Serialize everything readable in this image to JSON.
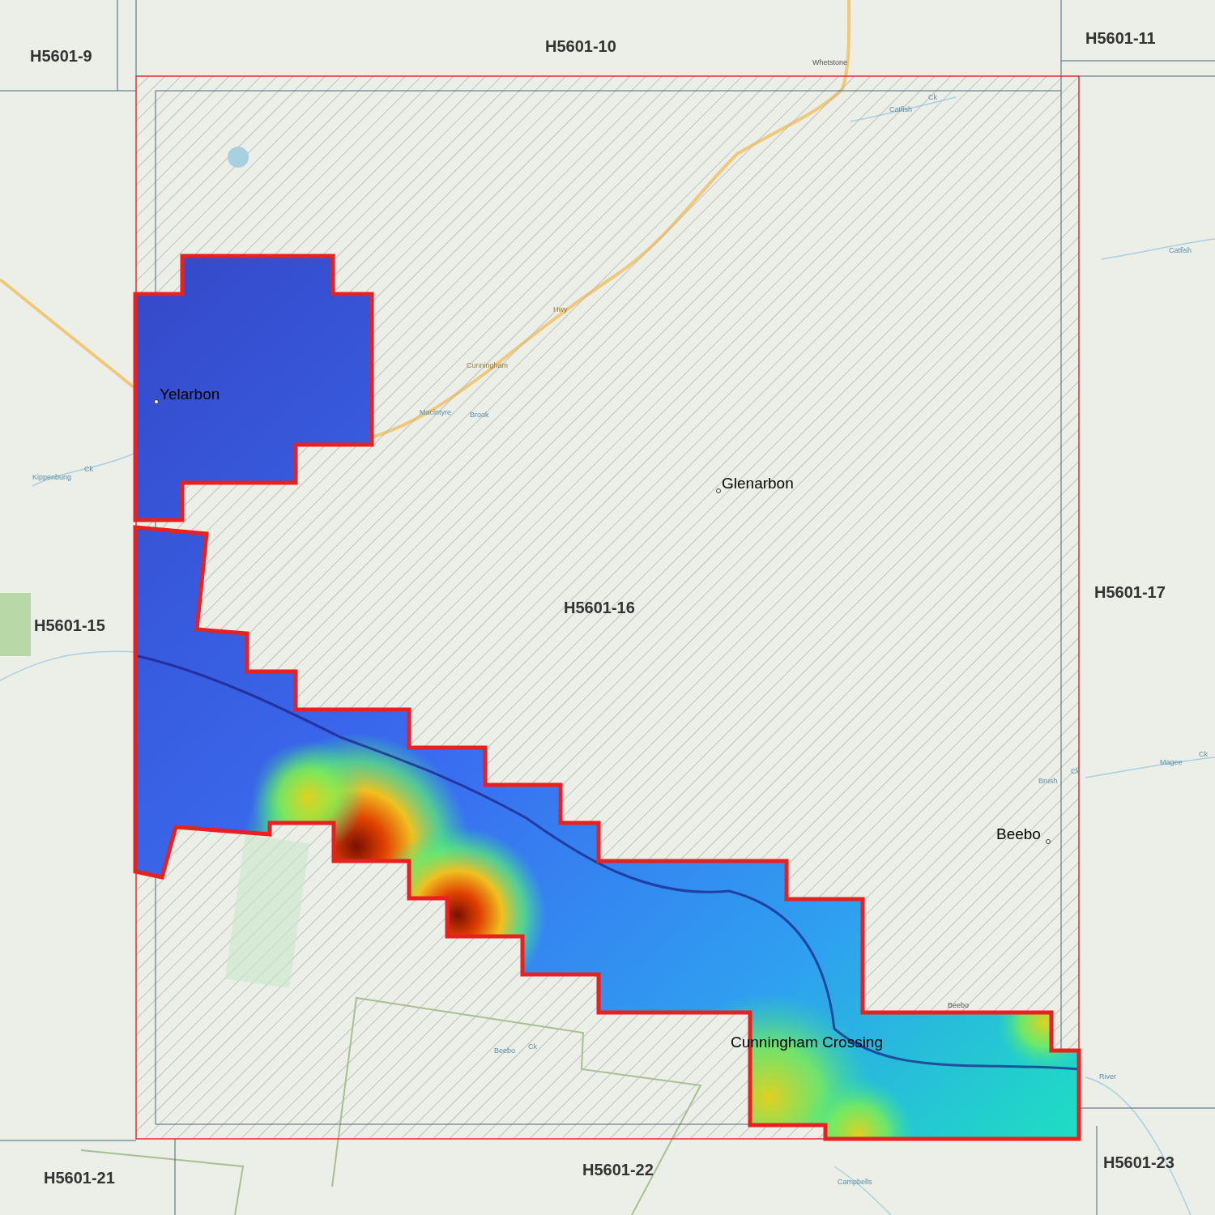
{
  "map": {
    "tile_labels": [
      "H5601-9",
      "H5601-10",
      "H5601-11",
      "H5601-15",
      "H5601-16",
      "H5601-17",
      "H5601-21",
      "H5601-22",
      "H5601-23"
    ],
    "place_labels": [
      "Yelarbon",
      "Glenarbon",
      "Beebo",
      "Cunningham Crossing"
    ],
    "feature_labels": [
      {
        "text": "Whetstone",
        "kind": "locality"
      },
      {
        "text": "Catfish",
        "kind": "water"
      },
      {
        "text": "Ck",
        "kind": "water"
      },
      {
        "text": "Cunningham",
        "kind": "road"
      },
      {
        "text": "Hwy",
        "kind": "road"
      },
      {
        "text": "Macintyre",
        "kind": "water"
      },
      {
        "text": "Brook",
        "kind": "water"
      },
      {
        "text": "Kippenbung",
        "kind": "water"
      },
      {
        "text": "Ck",
        "kind": "water"
      },
      {
        "text": "Brush",
        "kind": "water"
      },
      {
        "text": "Ck",
        "kind": "water"
      },
      {
        "text": "Magee",
        "kind": "water"
      },
      {
        "text": "Ck",
        "kind": "water"
      },
      {
        "text": "Beebo",
        "kind": "locality"
      },
      {
        "text": "River",
        "kind": "water"
      },
      {
        "text": "Beebo",
        "kind": "water"
      },
      {
        "text": "Ck",
        "kind": "water"
      },
      {
        "text": "Campbells",
        "kind": "water"
      },
      {
        "text": "Catfish",
        "kind": "water"
      }
    ]
  }
}
